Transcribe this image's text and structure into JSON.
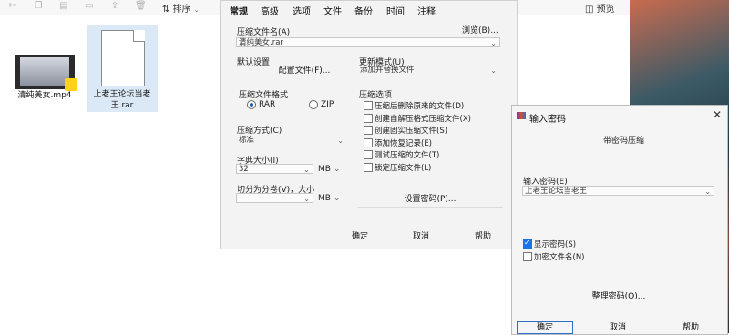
{
  "toolbar": {
    "sort_label": "排序",
    "preview_label": "预览"
  },
  "files": [
    {
      "name": "清纯美女.mp4"
    },
    {
      "name": "上老王论坛当老王.rar"
    }
  ],
  "archive_dialog": {
    "tabs": [
      "常规",
      "高级",
      "选项",
      "文件",
      "备份",
      "时间",
      "注释"
    ],
    "archive_name_label": "压缩文件名(A)",
    "browse_label": "浏览(B)...",
    "archive_name_value": "清纯美女.rar",
    "default_settings_label": "默认设置",
    "profiles_label": "配置文件(F)...",
    "update_mode_label": "更新模式(U)",
    "update_mode_value": "添加并替换文件",
    "format_label": "压缩文件格式",
    "format_rar": "RAR",
    "format_zip": "ZIP",
    "options_label": "压缩选项",
    "options": [
      {
        "label": "压缩后删除原来的文件(D)",
        "checked": false
      },
      {
        "label": "创建自解压格式压缩文件(X)",
        "checked": false
      },
      {
        "label": "创建固实压缩文件(S)",
        "checked": false
      },
      {
        "label": "添加恢复记录(E)",
        "checked": false
      },
      {
        "label": "测试压缩的文件(T)",
        "checked": false
      },
      {
        "label": "锁定压缩文件(L)",
        "checked": false
      }
    ],
    "method_label": "压缩方式(C)",
    "method_value": "标准",
    "dict_label": "字典大小(I)",
    "dict_value": "32",
    "dict_unit": "MB",
    "split_label": "切分为分卷(V)，大小",
    "split_value": "",
    "split_unit": "MB",
    "set_password_label": "设置密码(P)...",
    "ok_label": "确定",
    "cancel_label": "取消",
    "help_label": "帮助"
  },
  "password_dialog": {
    "title": "输入密码",
    "subtitle": "带密码压缩",
    "enter_label": "输入密码(E)",
    "password_value": "上老王论坛当老王",
    "show_password_label": "显示密码(S)",
    "show_password_checked": true,
    "encrypt_names_label": "加密文件名(N)",
    "encrypt_names_checked": false,
    "organize_label": "整理密码(O)...",
    "ok_label": "确定",
    "cancel_label": "取消",
    "help_label": "帮助"
  }
}
